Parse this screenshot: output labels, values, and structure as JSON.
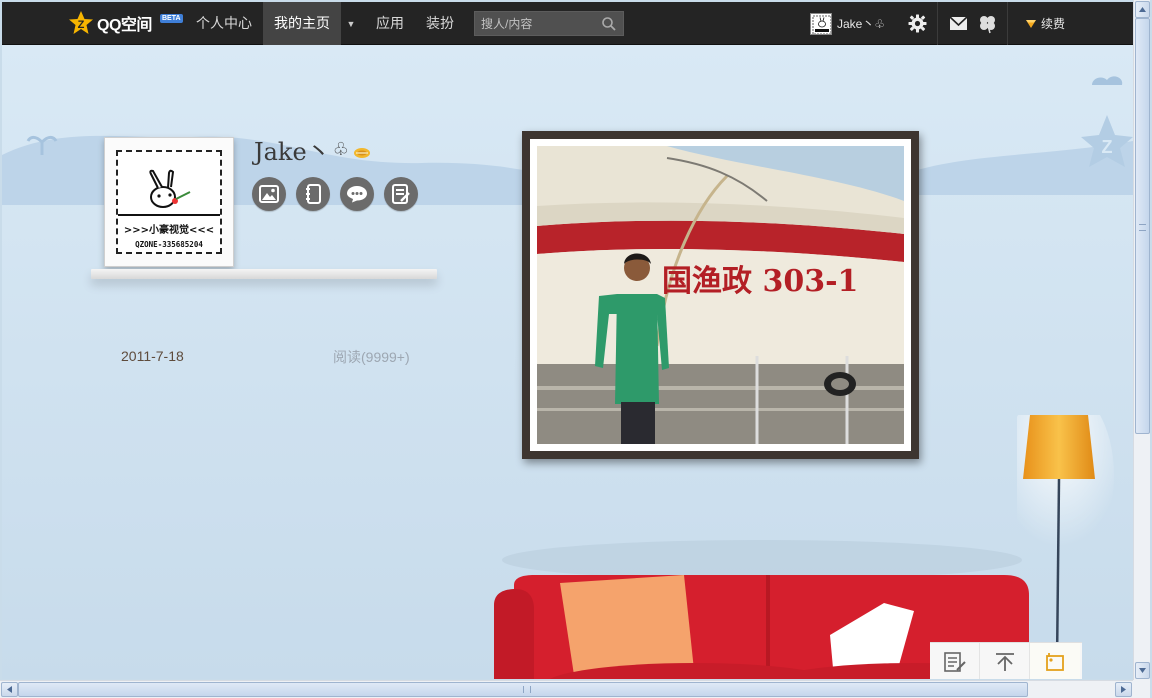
{
  "app": {
    "logo_text": "QQ空间",
    "logo_badge": "BETA"
  },
  "nav": {
    "items": [
      {
        "label": "个人中心"
      },
      {
        "label": "我的主页",
        "active": true
      },
      {
        "label": "应用"
      },
      {
        "label": "装扮"
      }
    ],
    "search_placeholder": "搜人/内容"
  },
  "user": {
    "name": "Jake丶♧",
    "renew_label": "续费"
  },
  "profile": {
    "avatar_caption_1": ">>>小豪视觉<<<",
    "avatar_caption_2": "QZONE-335685204",
    "name": "Jake丶",
    "name_suffix": "♧",
    "quick_icons": [
      "photo-icon",
      "diary-icon",
      "message-icon",
      "post-icon"
    ]
  },
  "post": {
    "date": "2011-7-18",
    "reads": "阅读(9999+)"
  },
  "photo": {
    "boat_text": "国渔政 303-1"
  },
  "colors": {
    "topbar": "#242424",
    "background": "#cde0ef",
    "accent": "#3f7fd8",
    "sofa": "#d51f2d",
    "lamp_shade": "#f4a81d"
  }
}
